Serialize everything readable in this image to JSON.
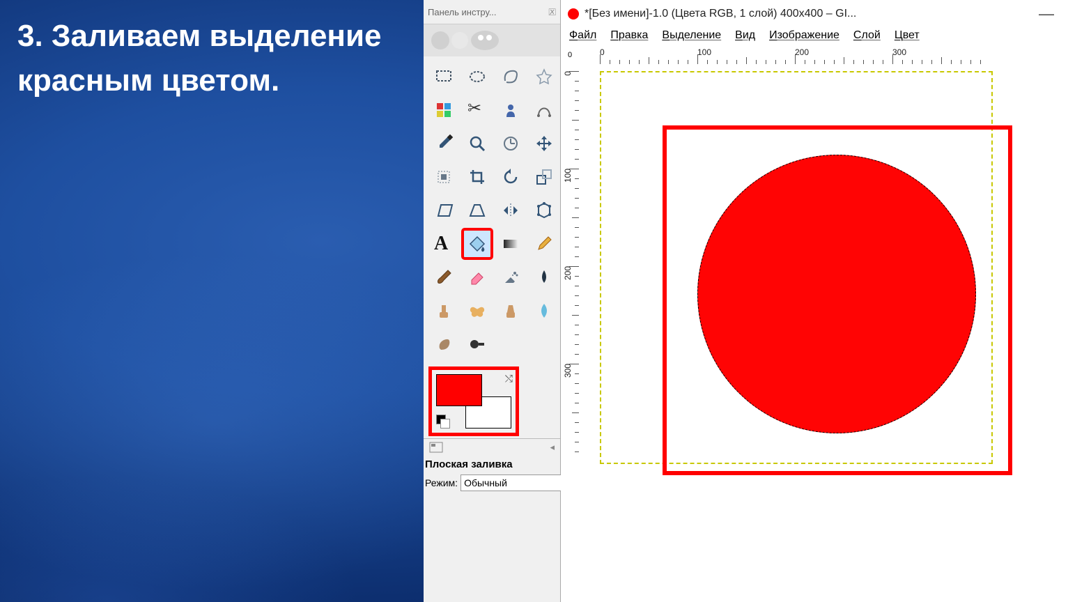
{
  "instruction": "3. Заливаем выделение красным цветом.",
  "toolbox": {
    "title": "Панель инстру...",
    "options_title": "Плоская заливка",
    "mode_label": "Режим:",
    "mode_value": "Обычный",
    "fg_color": "#ff0000",
    "bg_color": "#ffffff",
    "tools": [
      {
        "name": "rect-select",
        "label": "Rectangle Select"
      },
      {
        "name": "ellipse-select",
        "label": "Ellipse Select"
      },
      {
        "name": "free-select",
        "label": "Free Select"
      },
      {
        "name": "fuzzy-select",
        "label": "Fuzzy Select"
      },
      {
        "name": "by-color-select",
        "label": "By Color Select"
      },
      {
        "name": "scissors",
        "label": "Scissors"
      },
      {
        "name": "foreground-select",
        "label": "Foreground Select"
      },
      {
        "name": "paths",
        "label": "Paths"
      },
      {
        "name": "color-picker",
        "label": "Color Picker"
      },
      {
        "name": "zoom",
        "label": "Zoom"
      },
      {
        "name": "measure",
        "label": "Measure"
      },
      {
        "name": "move",
        "label": "Move"
      },
      {
        "name": "align",
        "label": "Align"
      },
      {
        "name": "crop",
        "label": "Crop"
      },
      {
        "name": "rotate",
        "label": "Rotate"
      },
      {
        "name": "scale",
        "label": "Scale"
      },
      {
        "name": "shear",
        "label": "Shear"
      },
      {
        "name": "perspective",
        "label": "Perspective"
      },
      {
        "name": "flip",
        "label": "Flip"
      },
      {
        "name": "cage",
        "label": "Cage"
      },
      {
        "name": "text",
        "label": "Text"
      },
      {
        "name": "bucket-fill",
        "label": "Bucket Fill",
        "highlighted": true
      },
      {
        "name": "blend",
        "label": "Blend"
      },
      {
        "name": "pencil",
        "label": "Pencil"
      },
      {
        "name": "paintbrush",
        "label": "Paintbrush"
      },
      {
        "name": "eraser",
        "label": "Eraser"
      },
      {
        "name": "airbrush",
        "label": "Airbrush"
      },
      {
        "name": "ink",
        "label": "Ink"
      },
      {
        "name": "clone",
        "label": "Clone"
      },
      {
        "name": "heal",
        "label": "Heal"
      },
      {
        "name": "perspective-clone",
        "label": "Perspective Clone"
      },
      {
        "name": "blur",
        "label": "Blur/Sharpen"
      },
      {
        "name": "smudge",
        "label": "Smudge"
      },
      {
        "name": "dodge",
        "label": "Dodge/Burn"
      }
    ]
  },
  "window": {
    "title": "*[Без имени]-1.0 (Цвета RGB, 1 слой) 400x400 – GI...",
    "menu": [
      "Файл",
      "Правка",
      "Выделение",
      "Вид",
      "Изображение",
      "Слой",
      "Цвет"
    ],
    "ruler_origin": "0",
    "h_ticks": [
      "0",
      "100",
      "200",
      "300"
    ],
    "v_ticks": [
      "0",
      "100",
      "200",
      "300"
    ]
  }
}
